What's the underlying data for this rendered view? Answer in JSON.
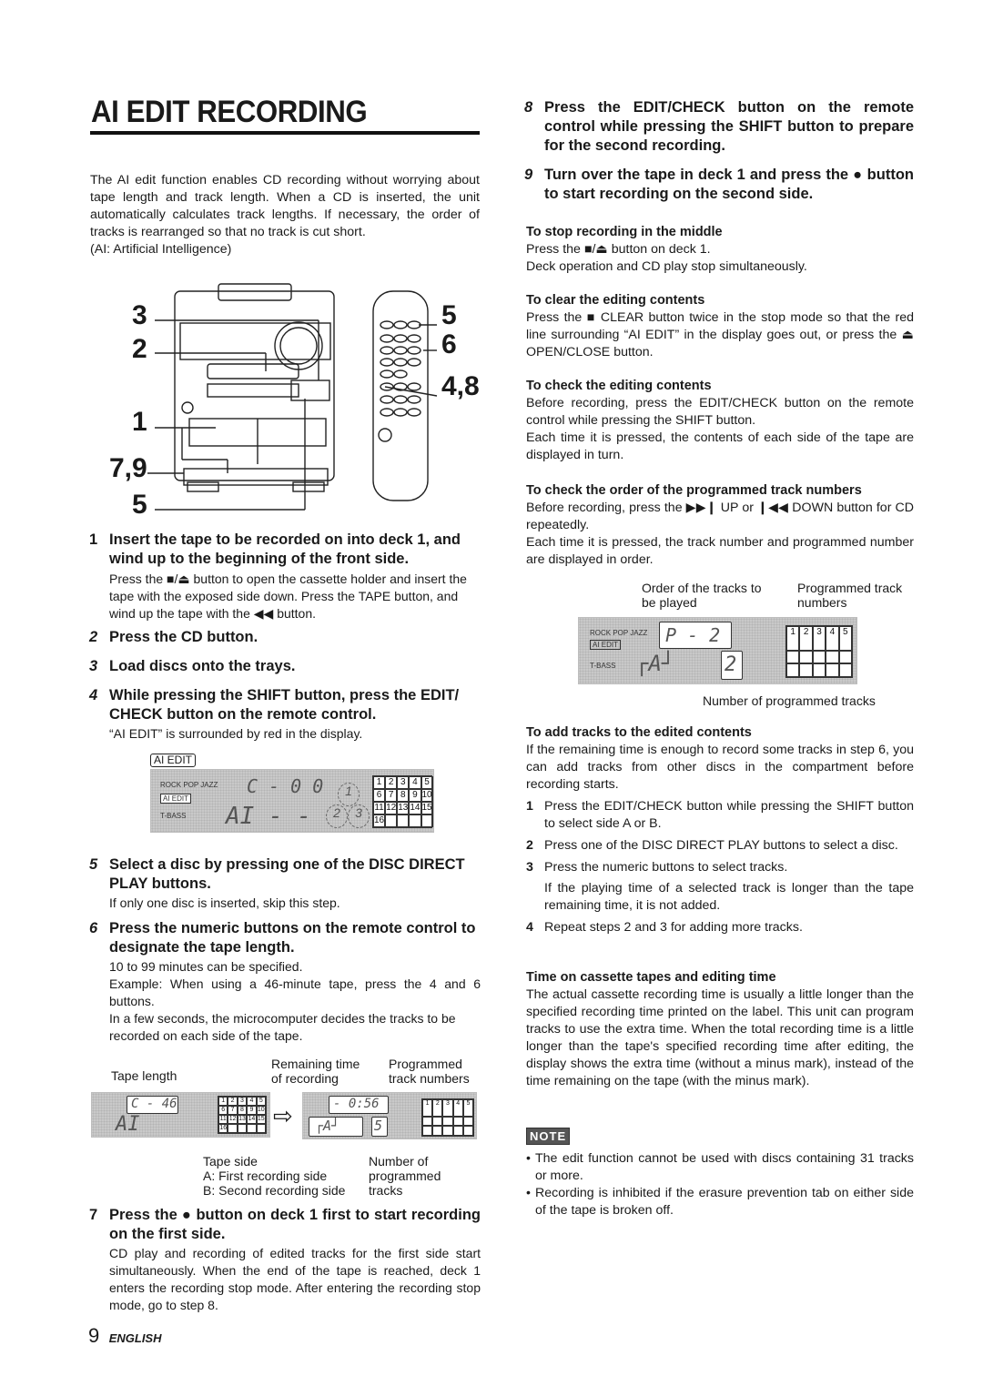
{
  "page": {
    "title": "AI EDIT RECORDING",
    "intro": "The AI edit function enables CD recording without worrying about tape length and track length.  When a CD is inserted, the unit automatically calculates track lengths.  If necessary, the order of tracks is rearranged so that no track is cut short.",
    "intro_note": "(AI: Artificial Intelligence)",
    "page_number": "9",
    "language": "ENGLISH"
  },
  "figure_main": {
    "unit_callouts": [
      "3",
      "2",
      "1",
      "7,9",
      "5"
    ],
    "remote_callouts": [
      "5",
      "6",
      "4,8"
    ]
  },
  "steps": [
    {
      "num": "1",
      "head": "Insert the tape to be recorded on into deck 1, and wind up to the beginning of the front side.",
      "body": "Press the ■/⏏ button to open the cassette holder and insert the tape with the exposed side down.  Press the TAPE button, and wind up the tape with the ◀◀ button."
    },
    {
      "num": "2",
      "head": "Press the CD button.",
      "body": ""
    },
    {
      "num": "3",
      "head": "Load discs onto the trays.",
      "body": ""
    },
    {
      "num": "4",
      "head": "While pressing the SHIFT button, press the EDIT/ CHECK button on the remote control.",
      "body": "“AI EDIT” is surrounded by red in the display."
    },
    {
      "num": "5",
      "head": "Select a disc by pressing one of the DISC DIRECT PLAY buttons.",
      "body": "If only one disc is inserted, skip this step."
    },
    {
      "num": "6",
      "head": "Press the numeric buttons on the remote control to designate the tape length.",
      "body": "10 to 99 minutes can be specified.",
      "body2": "Example: When using a 46-minute tape, press the 4 and 6 buttons.",
      "body3": "In a few seconds, the microcomputer decides the tracks to be recorded on each side of the tape."
    },
    {
      "num": "7",
      "head": "Press the ● button on deck 1 first to start recording on the first side.",
      "body": "CD play and recording of edited tracks for the first side start simultaneously.  When the end of the tape is reached, deck 1 enters the recording stop mode. After entering the recording stop mode, go to step 8."
    },
    {
      "num": "8",
      "head": "Press the EDIT/CHECK button on the remote control while pressing the SHIFT button to prepare for the second recording.",
      "body": ""
    },
    {
      "num": "9",
      "head": "Turn over the tape in deck 1 and press the ● button to start recording on the second side.",
      "body": ""
    }
  ],
  "display_step4": {
    "ai_edit_label": "AI EDIT",
    "modes": "ROCK POP JAZZ",
    "ai_edit_small": "AI EDIT",
    "tbass": "T-BASS",
    "top_digits": "C - 0 0",
    "bottom_digits": "AI - -",
    "discs": [
      "1",
      "2",
      "3"
    ],
    "grid": [
      "1",
      "2",
      "3",
      "4",
      "5",
      "6",
      "7",
      "8",
      "9",
      "10",
      "11",
      "12",
      "13",
      "14",
      "15",
      "16",
      "",
      "",
      "",
      ""
    ]
  },
  "display_step6": {
    "label_tape_length": "Tape length",
    "label_remaining": "Remaining time of recording",
    "label_programmed": "Programmed track numbers",
    "label_tape_side": "Tape side",
    "label_side_a": "A: First recording side",
    "label_side_b": "B: Second recording side",
    "label_num_prog": "Number of programmed tracks",
    "left_top": "C - 46",
    "left_bottom": "AI",
    "right_top": "-  0:56",
    "right_bottom": "┌A┘",
    "right_count": "5",
    "left_grid": [
      "1",
      "2",
      "3",
      "4",
      "5",
      "6",
      "7",
      "8",
      "9",
      "10",
      "11",
      "12",
      "13",
      "14",
      "15",
      "16",
      "",
      "",
      "",
      ""
    ],
    "right_grid": [
      "1",
      "2",
      "3",
      "4",
      "5",
      "",
      "",
      "",
      "",
      "",
      "",
      "",
      "",
      "",
      ""
    ]
  },
  "right_sections": [
    {
      "head": "To stop recording in the middle",
      "lines": [
        "Press the ■/⏏ button on deck 1.",
        "Deck operation and CD play stop simultaneously."
      ]
    },
    {
      "head": "To clear the editing contents",
      "lines": [
        "Press the ■ CLEAR button twice in the stop mode so that the red line surrounding “AI EDIT” in the display goes out, or press the ⏏ OPEN/CLOSE button."
      ]
    },
    {
      "head": "To check the editing contents",
      "lines": [
        "Before recording, press the EDIT/CHECK button on the remote control while pressing the SHIFT button.",
        "Each time it is pressed, the contents of each side of the tape are displayed in turn."
      ]
    },
    {
      "head": "To check the order of the programmed track numbers",
      "lines": [
        "Before recording, press the ▶▶❙ UP or ❙◀◀ DOWN button for CD repeatedly.",
        "Each time it is pressed, the track number and programmed number are displayed in order."
      ]
    }
  ],
  "display_order": {
    "label_order": "Order of  the tracks to be played",
    "label_prog": "Programmed track numbers",
    "label_num": "Number of programmed tracks",
    "modes": "ROCK POP JAZZ",
    "ai_edit_small": "AI EDIT",
    "tbass": "T-BASS",
    "top_digits": "P -   2",
    "bottom_digits": "┌A┘",
    "count": "2",
    "grid": [
      "1",
      "2",
      "3",
      "4",
      "5",
      "",
      "",
      "",
      "",
      "",
      "",
      "",
      "",
      "",
      ""
    ]
  },
  "add_tracks": {
    "head": "To add tracks to the edited contents",
    "intro": "If the remaining time is enough to record some tracks in step 6, you can add tracks from other discs in the compartment before recording starts.",
    "items": [
      {
        "num": "1",
        "text": "Press the EDIT/CHECK button while pressing the SHIFT button to select side A or B."
      },
      {
        "num": "2",
        "text": "Press one of the DISC DIRECT PLAY buttons to select a disc."
      },
      {
        "num": "3",
        "text": "Press the numeric buttons to select tracks.",
        "extra": "If the playing time of a selected track is longer than the tape remaining time, it is not added."
      },
      {
        "num": "4",
        "text": "Repeat steps 2 and 3 for adding more tracks."
      }
    ]
  },
  "time_section": {
    "head": "Time on cassette tapes and editing time",
    "body": "The actual cassette recording time is usually a little longer than the specified recording time printed on the label.  This unit can program tracks to use the extra time.  When the total recording time is a little longer than the tape's specified recording time after editing, the display shows the extra time (without a minus mark), instead of the time remaining on the tape (with the minus mark)."
  },
  "note": {
    "badge": "NOTE",
    "items": [
      "The edit function cannot be used with discs containing 31 tracks or more.",
      "Recording is inhibited if the erasure prevention tab on either side of the tape is broken off."
    ]
  }
}
